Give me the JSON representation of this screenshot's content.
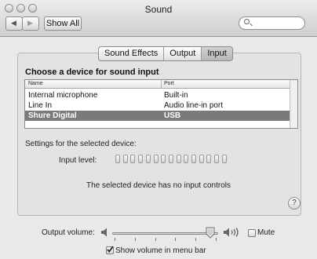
{
  "window": {
    "title": "Sound"
  },
  "toolbar": {
    "back_glyph": "◀",
    "forward_glyph": "▶",
    "show_all_label": "Show All",
    "search": {
      "value": "",
      "placeholder": ""
    }
  },
  "tabs": [
    {
      "label": "Sound Effects",
      "selected": false
    },
    {
      "label": "Output",
      "selected": false
    },
    {
      "label": "Input",
      "selected": true
    }
  ],
  "device_list": {
    "heading": "Choose a device for sound input",
    "columns": [
      "Name",
      "Port"
    ],
    "rows": [
      {
        "name": "Internal microphone",
        "port": "Built-in",
        "selected": false
      },
      {
        "name": "Line In",
        "port": "Audio line-in port",
        "selected": false
      },
      {
        "name": "Shure Digital",
        "port": "USB",
        "selected": true
      }
    ]
  },
  "settings": {
    "label": "Settings for the selected device:",
    "input_level_label": "Input level:",
    "input_level_segments": 15,
    "input_level_lit": 0,
    "no_controls_message": "The selected device has no input controls"
  },
  "help": {
    "glyph": "?"
  },
  "output": {
    "volume_label": "Output volume:",
    "volume_level": 0.97,
    "mute_label": "Mute",
    "mute_checked": false,
    "show_volume_label": "Show volume in menu bar",
    "show_volume_checked": true
  },
  "colors": {
    "selection": "#7a7a7a",
    "window_bg": "#e9e9e9"
  }
}
